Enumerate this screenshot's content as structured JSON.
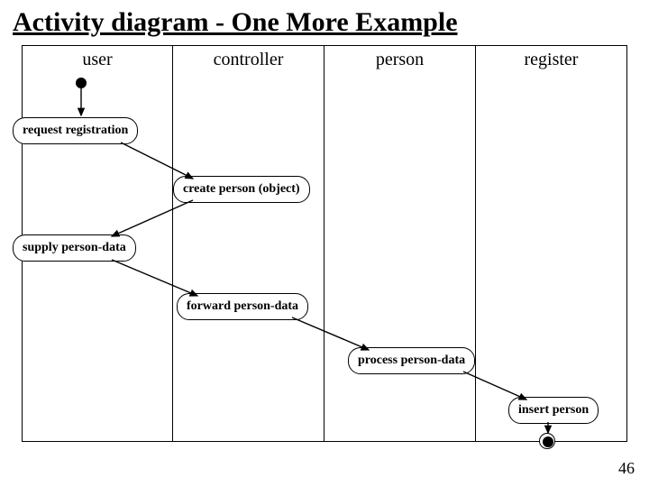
{
  "title": "Activity diagram - One More Example",
  "page_number": "46",
  "lanes": {
    "user": "user",
    "controller": "controller",
    "person": "person",
    "register": "register"
  },
  "activities": {
    "request_registration": "request registration",
    "create_person": "create person (object)",
    "supply_person_data": "supply person-data",
    "forward_person_data": "forward person-data",
    "process_person_data": "process person-data",
    "insert_person": "insert person"
  }
}
